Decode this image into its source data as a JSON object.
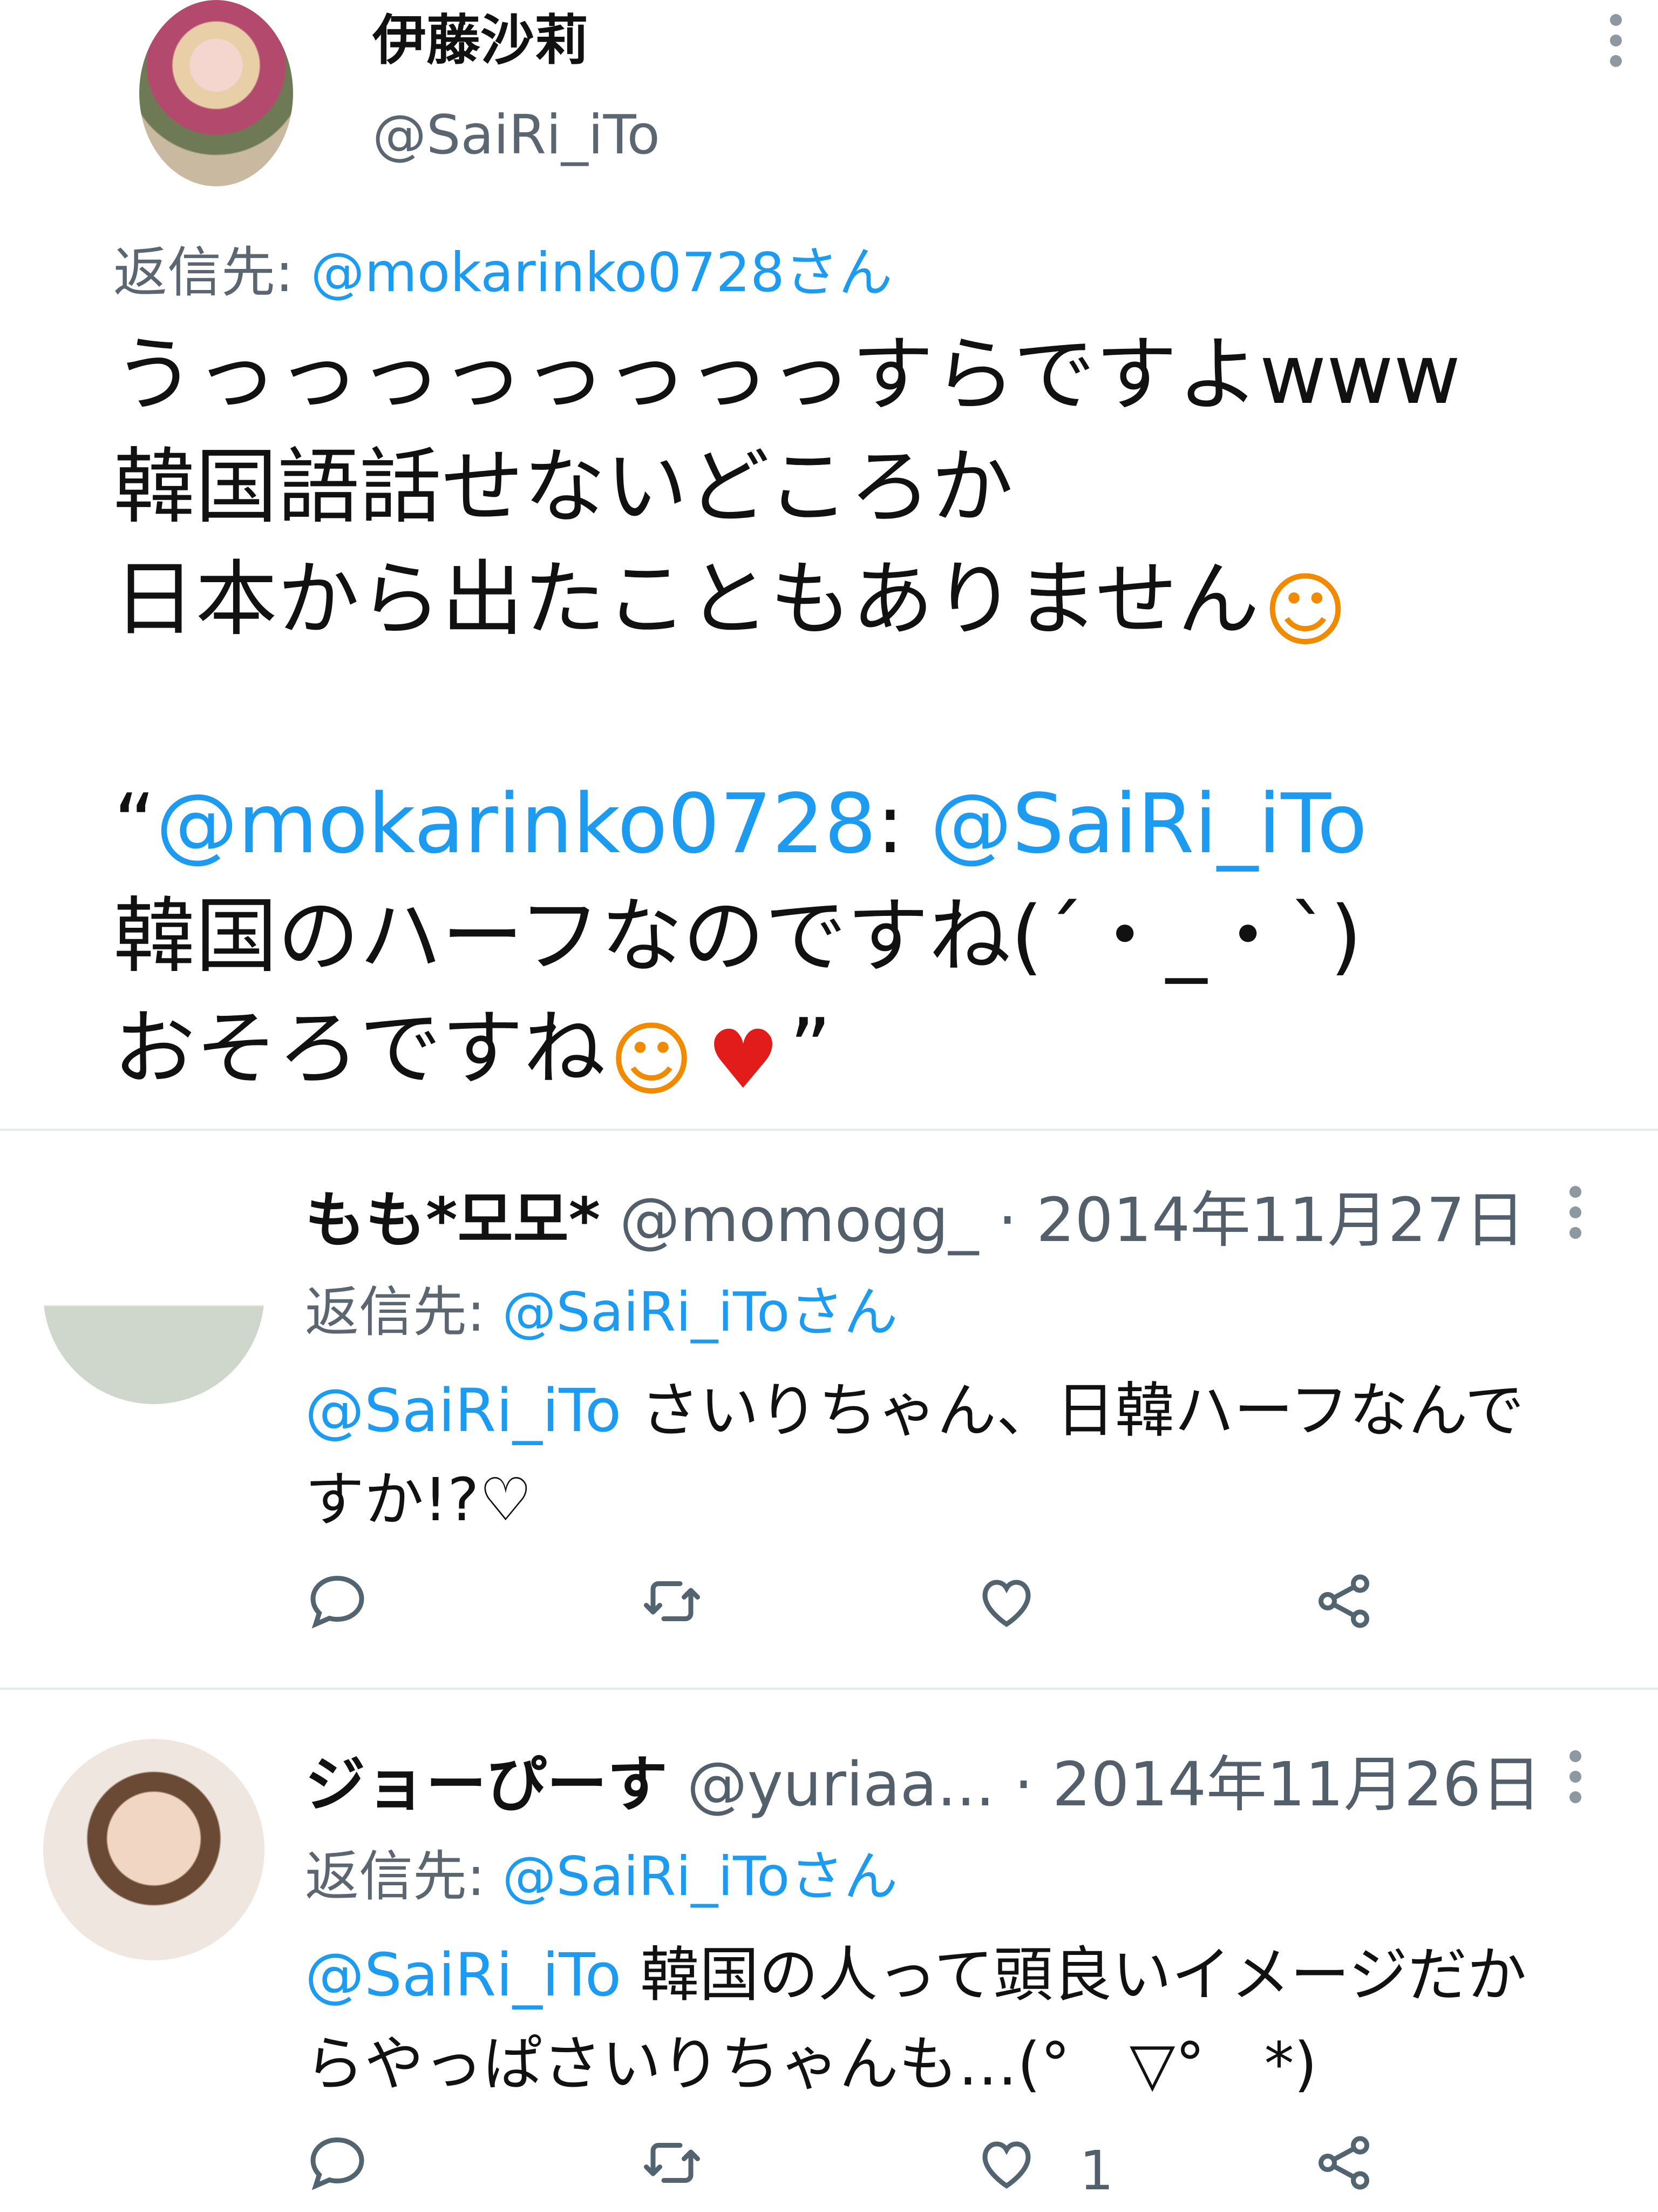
{
  "main_tweet": {
    "author_name": "伊藤沙莉",
    "author_handle": "@SaiRi_iTo",
    "reply_prefix": "返信先: ",
    "reply_target": "@mokarinko0728さん",
    "lines": [
      "うっっっっっっっっすらですよwww",
      "韓国語話せないどころか",
      "日本から出たこともありません"
    ],
    "quote_open": "“",
    "quote_handle": "@mokarinko0728",
    "quote_sep": ": ",
    "quote_mention": "@SaiRi_iTo",
    "quote_line2": "韓国のハーフなのですね(´・_・`)",
    "quote_line3": "おそろですね",
    "quote_close": "”",
    "emoji_hand": "hand-wave-emoji",
    "emoji_heart": "two-hearts-emoji"
  },
  "replies": [
    {
      "name": "もも*모모*",
      "handle": "@momogg_",
      "sep": " · ",
      "date": "2014年11月27日",
      "reply_prefix": "返信先: ",
      "reply_target": "@SaiRi_iToさん",
      "mention": "@SaiRi_iTo",
      "text_line1": " さいりちゃん、日韓ハーフなんで",
      "text_line2": "すか!?♡",
      "like_count": ""
    },
    {
      "name": "ジョーぴーす",
      "handle": "@yuriaa...",
      "sep": " · ",
      "date": "2014年11月26日",
      "reply_prefix": "返信先: ",
      "reply_target": "@SaiRi_iToさん",
      "mention": "@SaiRi_iTo",
      "text_line1": " 韓国の人って頭良いイメージだか",
      "text_line2": "らやっぱさいりちゃんも…(°　▽°　*)",
      "like_count": "1"
    }
  ],
  "icons": {
    "reply": "reply-icon",
    "retweet": "retweet-icon",
    "like": "like-icon",
    "share": "share-icon",
    "more": "more-icon"
  },
  "colors": {
    "link": "#1d9bf0",
    "secondary_text": "#53606b",
    "divider": "#e6e9ec"
  }
}
